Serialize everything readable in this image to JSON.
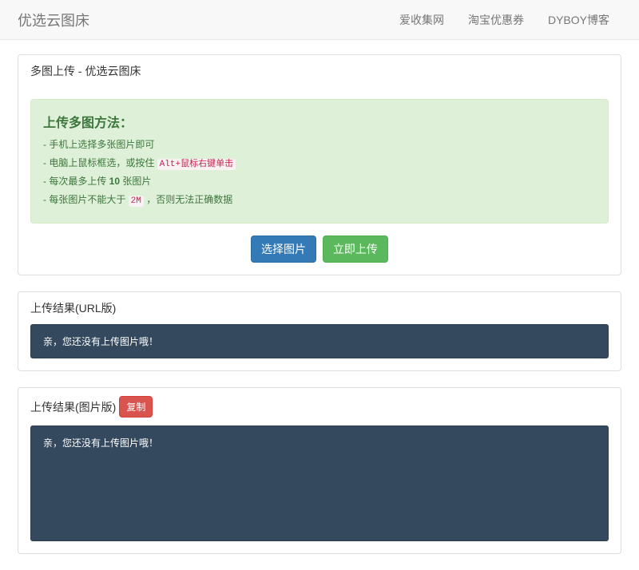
{
  "navbar": {
    "brand": "优选云图床",
    "links": [
      "爱收集网",
      "淘宝优惠券",
      "DYBOY博客"
    ]
  },
  "upload_panel": {
    "heading": "多图上传 - 优选云图床",
    "method_title": "上传多图方法：",
    "line1_pre": "- 手机上选择多张图片即可",
    "line2_pre": "- 电脑上鼠标框选，或按住 ",
    "line2_code": "Alt+鼠标右键单击",
    "line3_a": "- 每次最多上传 ",
    "line3_b": "10",
    "line3_c": " 张图片",
    "line4_a": "- 每张图片不能大于 ",
    "line4_code": "2M",
    "line4_b": " ，否则无法正确数据",
    "btn_select": "选择图片",
    "btn_upload": "立即上传"
  },
  "result_url": {
    "heading": "上传结果(URL版)",
    "empty": "亲，您还没有上传图片哦！"
  },
  "result_img": {
    "heading": "上传结果(图片版)",
    "copy": "复制",
    "empty": "亲，您还没有上传图片哦！"
  }
}
